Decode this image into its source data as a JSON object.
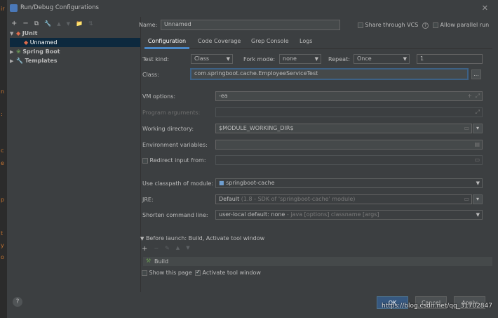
{
  "window": {
    "title": "Run/Debug Configurations"
  },
  "toolbar": {
    "add": "+",
    "remove": "−",
    "copy": "⧉",
    "settings": "🔧",
    "up": "▲",
    "down": "▼",
    "folder": "📁",
    "sort": "⇅"
  },
  "tree": {
    "junit": "JUnit",
    "unnamed": "Unnamed",
    "spring_boot": "Spring Boot",
    "templates": "Templates"
  },
  "header": {
    "name_label": "Name:",
    "name_value": "Unnamed",
    "share_vcs": "Share through VCS",
    "allow_parallel": "Allow parallel run"
  },
  "tabs": [
    "Configuration",
    "Code Coverage",
    "Grep Console",
    "Logs"
  ],
  "form": {
    "test_kind_label": "Test kind:",
    "test_kind_value": "Class",
    "fork_mode_label": "Fork mode:",
    "fork_mode_value": "none",
    "repeat_label": "Repeat:",
    "repeat_value": "Once",
    "repeat_count": "1",
    "class_label": "Class:",
    "class_value": "com.springboot.cache.EmployeeServiceTest",
    "browse": "...",
    "vm_options_label": "VM options:",
    "vm_options_value": "-ea",
    "program_args_label": "Program arguments:",
    "working_dir_label": "Working directory:",
    "working_dir_value": "$MODULE_WORKING_DIR$",
    "env_vars_label": "Environment variables:",
    "redirect_label": "Redirect input from:",
    "classpath_label": "Use classpath of module:",
    "classpath_value": "springboot-cache",
    "jre_label": "JRE:",
    "jre_value": "Default",
    "jre_hint": "(1.8 - SDK of 'springboot-cache' module)",
    "shorten_label": "Shorten command line:",
    "shorten_value": "user-local default: none",
    "shorten_hint": "- java [options] classname [args]"
  },
  "before_launch": {
    "title": "Before launch: Build, Activate tool window",
    "item": "Build",
    "show_page": "Show this page",
    "activate_window": "Activate tool window"
  },
  "footer": {
    "ok": "OK",
    "cancel": "Cancel",
    "apply": "Apply",
    "help": "?"
  },
  "watermark": "https://blog.csdn.net/qq_31702847",
  "edge_letters": [
    "ir",
    "n",
    ":",
    "c",
    "e",
    "p",
    "t",
    "y",
    "o"
  ]
}
